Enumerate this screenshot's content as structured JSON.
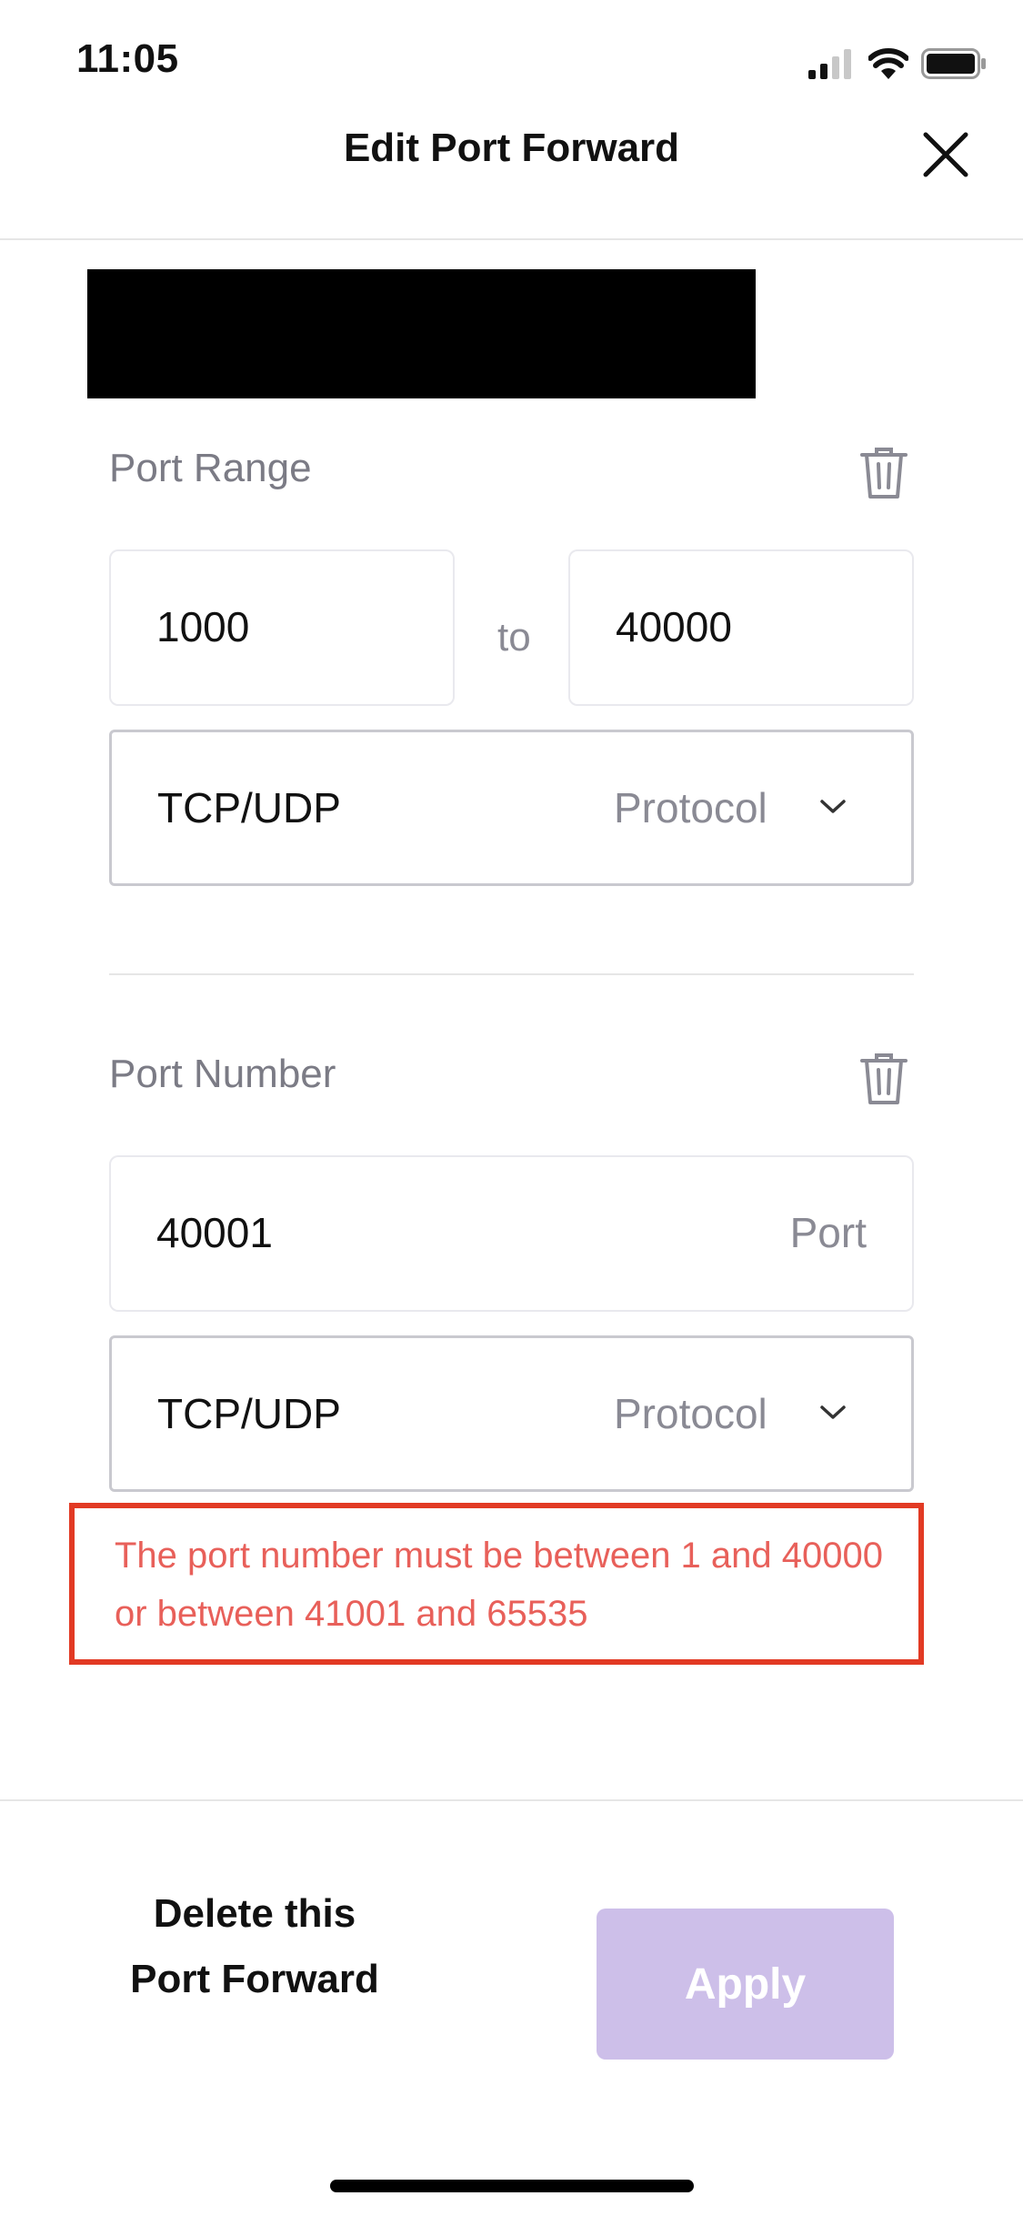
{
  "status_bar": {
    "time": "11:05",
    "icons": [
      "cellular-signal-icon",
      "wifi-icon",
      "battery-icon"
    ]
  },
  "header": {
    "title": "Edit Port Forward",
    "close_icon": "close-icon"
  },
  "port_range": {
    "label": "Port Range",
    "start_value": "1000",
    "to_label": "to",
    "end_value": "40000",
    "protocol_value": "TCP/UDP",
    "protocol_hint": "Protocol"
  },
  "port_number": {
    "label": "Port Number",
    "value": "40001",
    "hint": "Port",
    "protocol_value": "TCP/UDP",
    "protocol_hint": "Protocol"
  },
  "error": {
    "message": "The port number must be between 1 and 40000 or between 41001 and 65535"
  },
  "footer": {
    "delete_label": "Delete this Port Forward",
    "apply_label": "Apply"
  },
  "colors": {
    "error_red": "#e23a24",
    "error_text": "#e8605a",
    "apply_disabled": "#cdbfe9",
    "hint_gray": "#8a8a94"
  }
}
